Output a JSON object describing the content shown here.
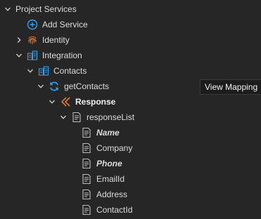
{
  "colors": {
    "background": "#262626",
    "text": "#dcdcdc",
    "accent_blue": "#3aa0e8",
    "accent_orange": "#e07a2e",
    "icon_gray": "#bdbdbd"
  },
  "tree": {
    "root": {
      "label": "Project Services",
      "icon": "chevron-down-icon"
    },
    "add_service": {
      "label": "Add Service",
      "icon": "plus-circle-icon"
    },
    "identity": {
      "label": "Identity",
      "icon": "fingerprint-icon"
    },
    "integration": {
      "label": "Integration",
      "icon": "chevron-down-icon"
    },
    "contacts": {
      "label": "Contacts",
      "icon": "integration-service-icon"
    },
    "get_contacts": {
      "label": "getContacts",
      "icon": "sync-icon"
    },
    "response": {
      "label": "Response",
      "icon": "response-icon"
    },
    "response_list": {
      "label": "responseList",
      "icon": "list-document-icon"
    },
    "fields": [
      {
        "label": "Name",
        "style": "bold-italic"
      },
      {
        "label": "Company",
        "style": "normal"
      },
      {
        "label": "Phone",
        "style": "bold-italic"
      },
      {
        "label": "EmailId",
        "style": "normal"
      },
      {
        "label": "Address",
        "style": "normal"
      },
      {
        "label": "ContactId",
        "style": "normal"
      }
    ]
  },
  "tooltip": {
    "text": "View Mapping"
  }
}
